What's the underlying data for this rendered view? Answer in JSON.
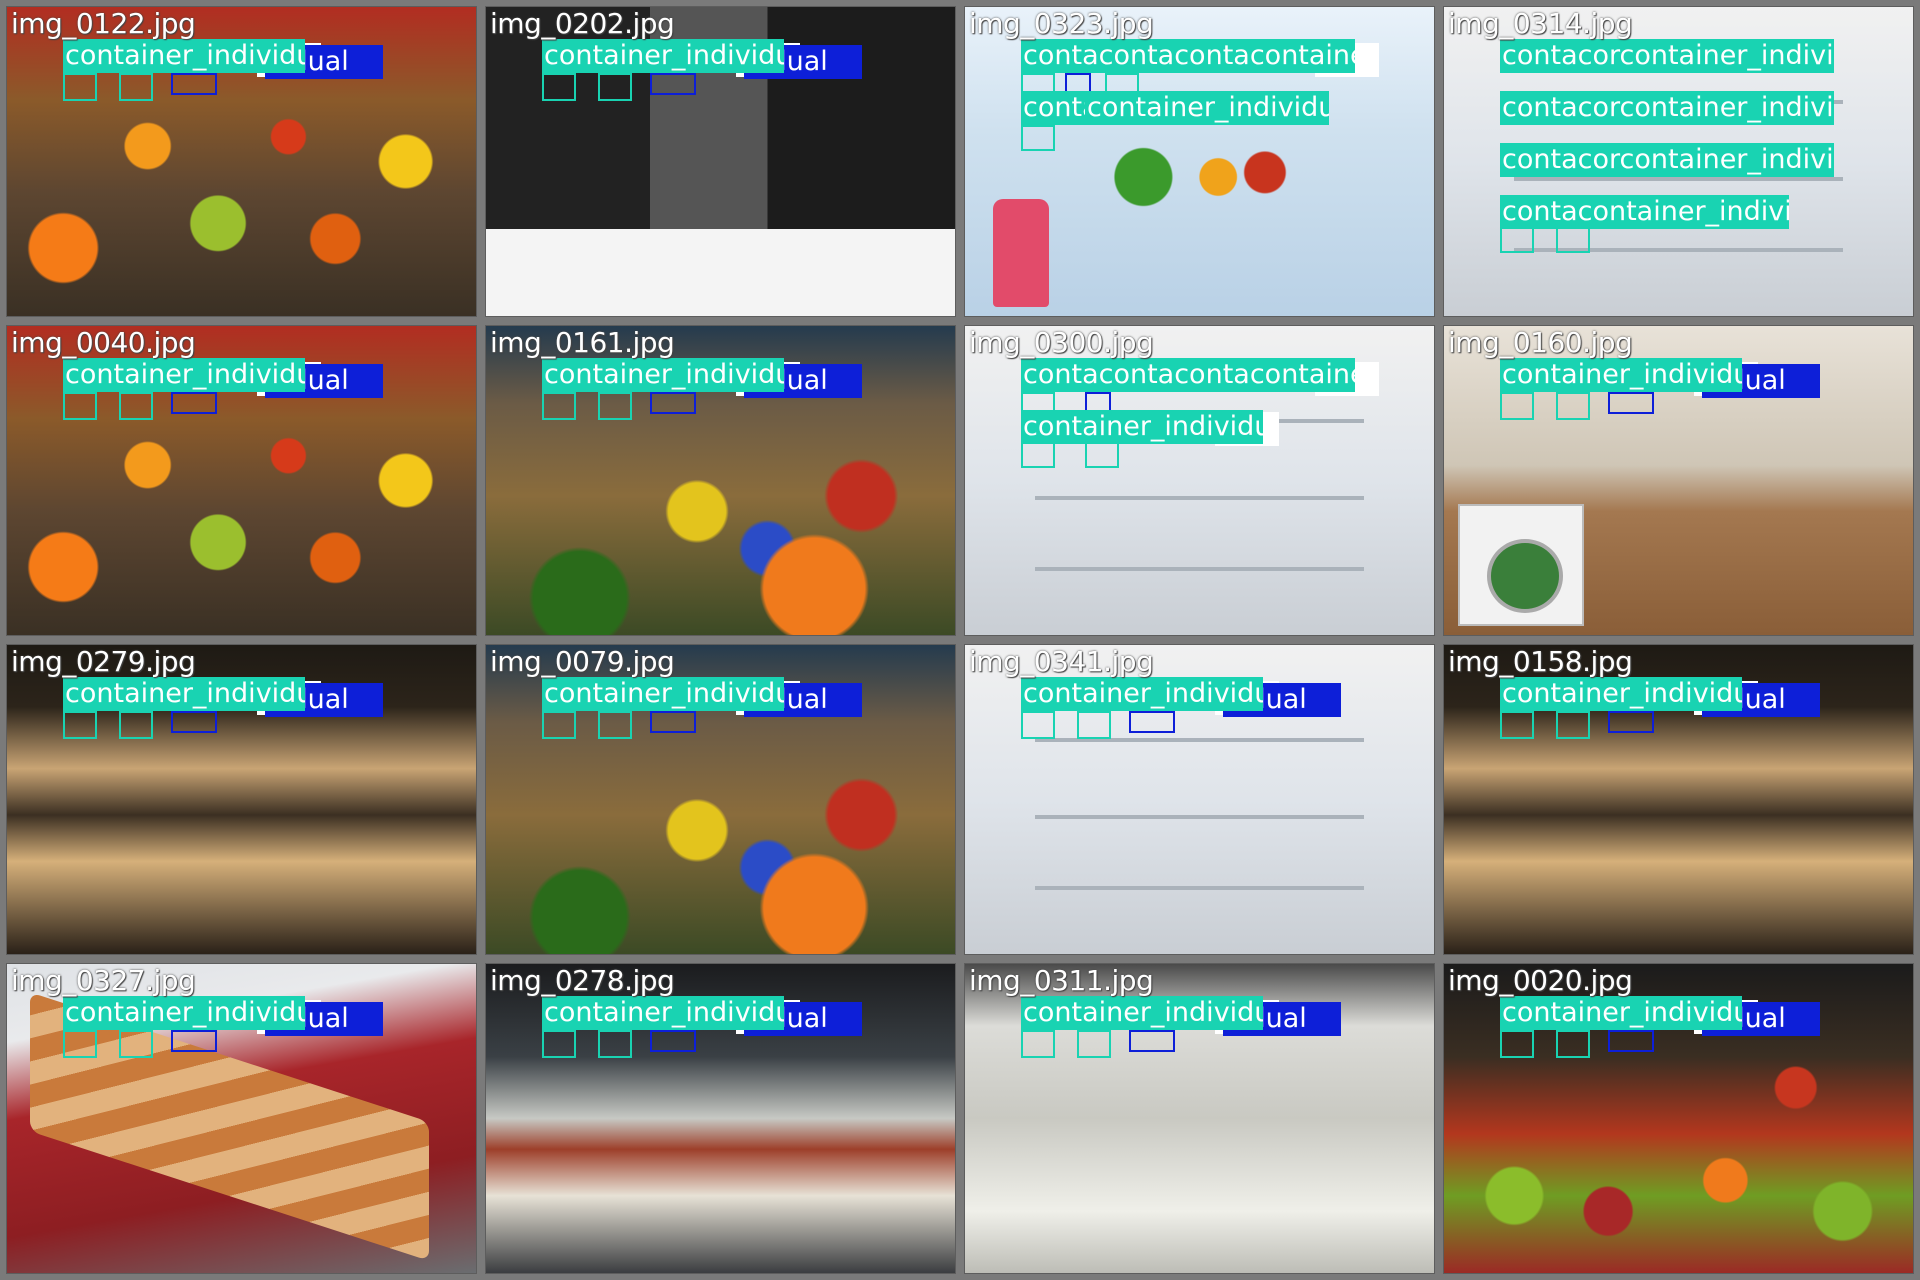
{
  "tiles": [
    {
      "filename": "img_0122.jpg",
      "scene": "s-fruit"
    },
    {
      "filename": "img_0202.jpg",
      "scene": "s-bw"
    },
    {
      "filename": "img_0323.jpg",
      "scene": "s-fridge"
    },
    {
      "filename": "img_0314.jpg",
      "scene": "s-fridge2"
    },
    {
      "filename": "img_0040.jpg",
      "scene": "s-fruit"
    },
    {
      "filename": "img_0161.jpg",
      "scene": "s-market"
    },
    {
      "filename": "img_0300.jpg",
      "scene": "s-fridge2"
    },
    {
      "filename": "img_0160.jpg",
      "scene": "s-kitchen"
    },
    {
      "filename": "img_0279.jpg",
      "scene": "s-bakery"
    },
    {
      "filename": "img_0079.jpg",
      "scene": "s-market"
    },
    {
      "filename": "img_0341.jpg",
      "scene": "s-fridge2"
    },
    {
      "filename": "img_0158.jpg",
      "scene": "s-bakery"
    },
    {
      "filename": "img_0327.jpg",
      "scene": "s-sandwich2"
    },
    {
      "filename": "img_0278.jpg",
      "scene": "s-sandwich"
    },
    {
      "filename": "img_0311.jpg",
      "scene": "s-fridge3"
    },
    {
      "filename": "img_0020.jpg",
      "scene": "s-apples"
    }
  ],
  "labels": {
    "full": "container_individual",
    "tail": "vidual",
    "short": "conta",
    "short2": "cont",
    "fragment": "al",
    "long_run": "contacontacontacontainer_individua"
  },
  "colors": {
    "teal": "#19d3b2",
    "blue": "#0d1fd8",
    "background": "#7a7a7a"
  }
}
